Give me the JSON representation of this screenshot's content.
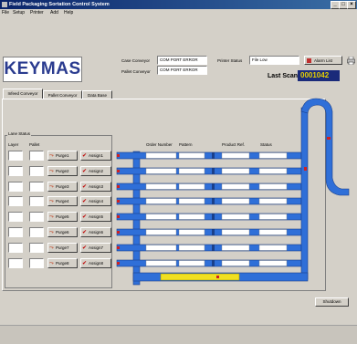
{
  "window": {
    "title": "Field Packaging Sortation Control System",
    "buttons": [
      "_",
      "□",
      "×"
    ]
  },
  "menu": [
    "File",
    "Setup",
    "Printer",
    "Add",
    "Help"
  ],
  "logo": "KEYMAS",
  "header": {
    "case_conveyor_label": "Case Conveyor",
    "case_conveyor_value": "COM PORT ERROR",
    "pallet_conveyor_label": "Pallet Conveyor",
    "pallet_conveyor_value": "COM PORT ERROR",
    "printer_status_label": "Printer Status",
    "printer_status_value": "File Low",
    "alarm_label": "Alarm List",
    "last_scan_label": "Last Scan",
    "last_scan_value": "0001042"
  },
  "tabs": [
    "Infeed Conveyor",
    "Pallet Conveyor",
    "Data Base"
  ],
  "lane_status": {
    "title": "Lane Status",
    "col_layer": "Layer",
    "col_pallet": "Pallet",
    "rows": [
      {
        "purge": "Purge1",
        "assign": "Assign1"
      },
      {
        "purge": "Purge2",
        "assign": "Assign2"
      },
      {
        "purge": "Purge3",
        "assign": "Assign3"
      },
      {
        "purge": "Purge4",
        "assign": "Assign4"
      },
      {
        "purge": "Purge5",
        "assign": "Assign5"
      },
      {
        "purge": "Purge6",
        "assign": "Assign6"
      },
      {
        "purge": "Purge7",
        "assign": "Assign7"
      },
      {
        "purge": "Purge8",
        "assign": "Assign8"
      }
    ]
  },
  "conveyor_table": {
    "headers": [
      "Order Number",
      "Pattern",
      "Product Ref.",
      "Status"
    ]
  },
  "shutdown_label": "Shutdown",
  "colors": {
    "conveyor": "#2f6fd8",
    "conveyor_dark": "#1a3f8a",
    "highlight": "#f0e020",
    "sensor": "#d02020"
  }
}
